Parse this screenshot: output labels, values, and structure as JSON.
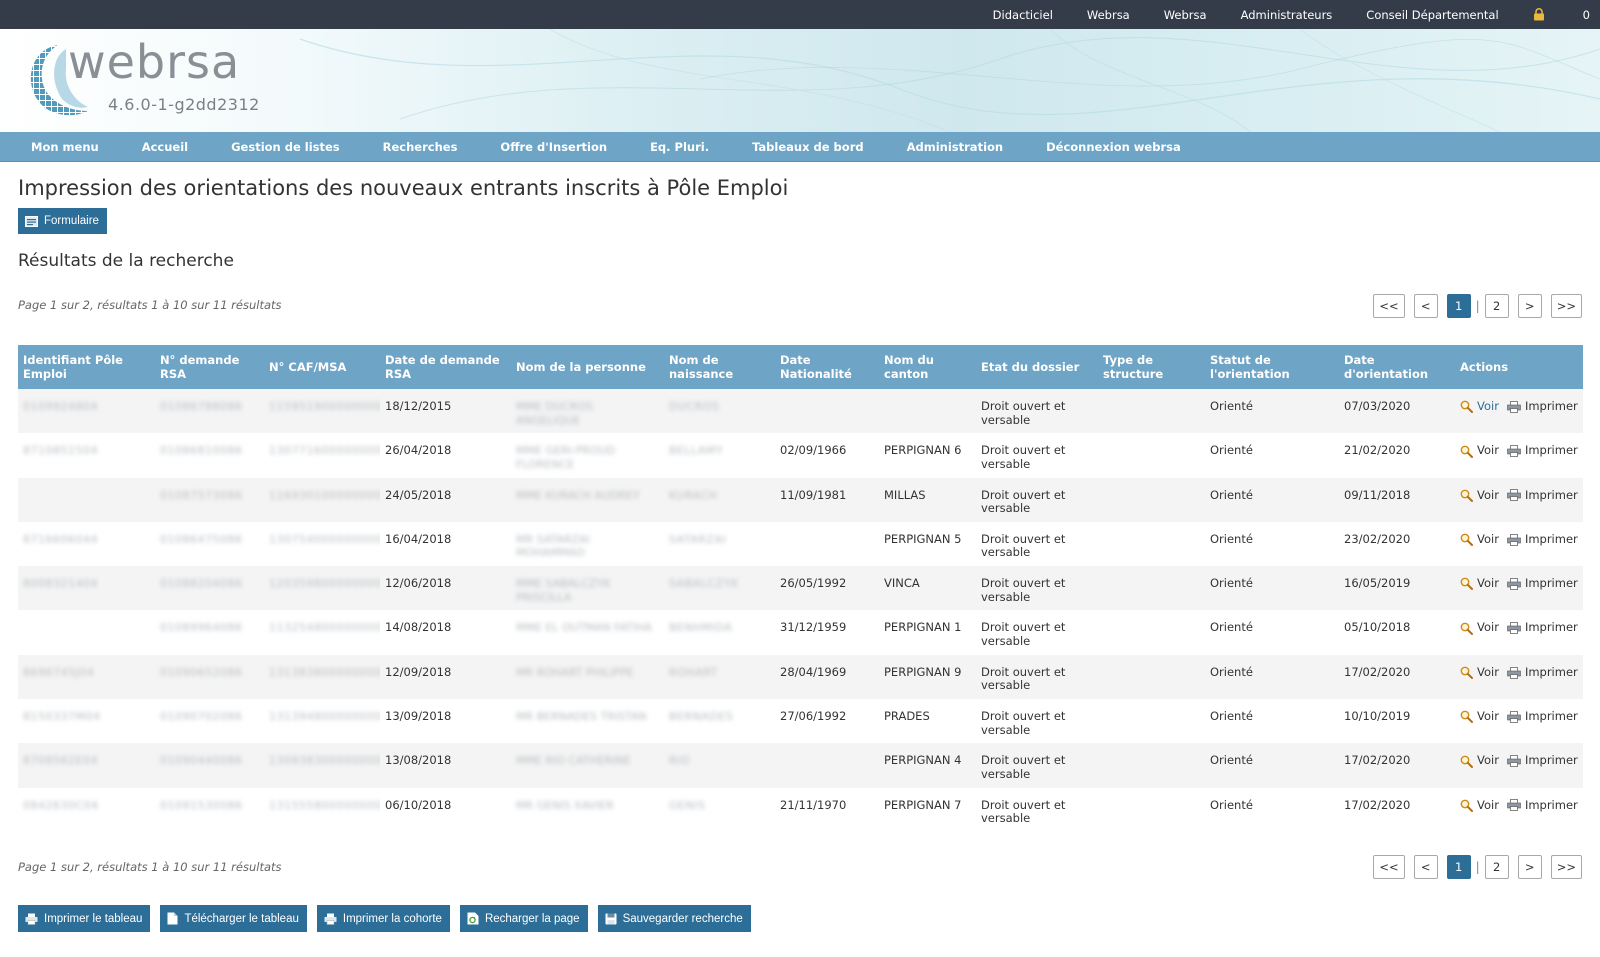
{
  "topbar": {
    "links": [
      "Didacticiel",
      "Webrsa",
      "Webrsa",
      "Administrateurs",
      "Conseil Départemental"
    ],
    "lock_count": "0"
  },
  "logo": {
    "word": "webrsa",
    "version": "4.6.0-1-g2dd2312"
  },
  "nav": [
    "Mon menu",
    "Accueil",
    "Gestion de listes",
    "Recherches",
    "Offre d'Insertion",
    "Eq. Pluri.",
    "Tableaux de bord",
    "Administration",
    "Déconnexion webrsa"
  ],
  "page": {
    "title": "Impression des orientations des nouveaux entrants inscrits à Pôle Emploi",
    "form_button": "Formulaire",
    "results_title": "Résultats de la recherche",
    "page_info": "Page 1 sur 2, résultats 1 à 10 sur 11 résultats"
  },
  "pager": {
    "first": "<<",
    "prev": "<",
    "pages": [
      "1",
      "2"
    ],
    "next": ">",
    "last": ">>",
    "separator": "|"
  },
  "table": {
    "headers": [
      "Identifiant Pôle Emploi",
      "N° demande RSA",
      "N° CAF/MSA",
      "Date de demande RSA",
      "Nom de la personne",
      "Nom de naissance",
      "Date Nationalité",
      "Nom du canton",
      "Etat du dossier",
      "Type de structure",
      "Statut de l'orientation",
      "Date d'orientation",
      "Actions"
    ],
    "action_voir": "Voir",
    "action_imprimer": "Imprimer",
    "rows": [
      {
        "idpe": "0109924804",
        "ndem": "01086788086",
        "caf": "1159519000000000",
        "date_dem": "18/12/2015",
        "nom": "MME DUCROS ANGELIQUE",
        "naiss": "DUCROS",
        "date_nat": "",
        "canton": "",
        "etat": "Droit ouvert et versable",
        "type": "",
        "statut": "Orienté",
        "date_or": "07/03/2020"
      },
      {
        "idpe": "8710851504",
        "ndem": "01086810086",
        "caf": "1307716000000000",
        "date_dem": "26/04/2018",
        "nom": "MME GERI-PROUD FLORENCE",
        "naiss": "BELLAMY",
        "date_nat": "02/09/1966",
        "canton": "PERPIGNAN 6",
        "etat": "Droit ouvert et versable",
        "type": "",
        "statut": "Orienté",
        "date_or": "21/02/2020"
      },
      {
        "idpe": "",
        "ndem": "01087573086",
        "caf": "1169301000000000",
        "date_dem": "24/05/2018",
        "nom": "MME KURACH AUDREY",
        "naiss": "KURACH",
        "date_nat": "11/09/1981",
        "canton": "MILLAS",
        "etat": "Droit ouvert et versable",
        "type": "",
        "statut": "Orienté",
        "date_or": "09/11/2018"
      },
      {
        "idpe": "8716606044",
        "ndem": "01086475086",
        "caf": "1307540000000000",
        "date_dem": "16/04/2018",
        "nom": "MR SATARZAI MOHAMMAD",
        "naiss": "SATARZAI",
        "date_nat": "",
        "canton": "PERPIGNAN 5",
        "etat": "Droit ouvert et versable",
        "type": "",
        "statut": "Orienté",
        "date_or": "23/02/2020"
      },
      {
        "idpe": "8008321404",
        "ndem": "01088204086",
        "caf": "1203598000000000",
        "date_dem": "12/06/2018",
        "nom": "MME SABALCZYK PRISCILLA",
        "naiss": "SABALCZYK",
        "date_nat": "26/05/1992",
        "canton": "VINCA",
        "etat": "Droit ouvert et versable",
        "type": "",
        "statut": "Orienté",
        "date_or": "16/05/2019"
      },
      {
        "idpe": "",
        "ndem": "01089964086",
        "caf": "1132548000000000",
        "date_dem": "14/08/2018",
        "nom": "MME EL OUTMAN FATIHA",
        "naiss": "BENHMIDA",
        "date_nat": "31/12/1959",
        "canton": "PERPIGNAN 1",
        "etat": "Droit ouvert et versable",
        "type": "",
        "statut": "Orienté",
        "date_or": "05/10/2018"
      },
      {
        "idpe": "8696745J04",
        "ndem": "01090652086",
        "caf": "1313838000000000",
        "date_dem": "12/09/2018",
        "nom": "MR ROHART PHILIPPE",
        "naiss": "ROHART",
        "date_nat": "28/04/1969",
        "canton": "PERPIGNAN 9",
        "etat": "Droit ouvert et versable",
        "type": "",
        "statut": "Orienté",
        "date_or": "17/02/2020"
      },
      {
        "idpe": "8150337M04",
        "ndem": "01090702086",
        "caf": "1313948000000000",
        "date_dem": "13/09/2018",
        "nom": "MR BERNADES TRISTAN",
        "naiss": "BERNADES",
        "date_nat": "27/06/1992",
        "canton": "PRADES",
        "etat": "Droit ouvert et versable",
        "type": "",
        "statut": "Orienté",
        "date_or": "10/10/2019"
      },
      {
        "idpe": "8708562E04",
        "ndem": "01090440086",
        "caf": "1309383000000000",
        "date_dem": "13/08/2018",
        "nom": "MME RIO CATHERINE",
        "naiss": "RIO",
        "date_nat": "",
        "canton": "PERPIGNAN 4",
        "etat": "Droit ouvert et versable",
        "type": "",
        "statut": "Orienté",
        "date_or": "17/02/2020"
      },
      {
        "idpe": "0842630C04",
        "ndem": "01091530086",
        "caf": "1315558000000000",
        "date_dem": "06/10/2018",
        "nom": "MR GENIS XAVIER",
        "naiss": "GENIS",
        "date_nat": "21/11/1970",
        "canton": "PERPIGNAN 7",
        "etat": "Droit ouvert et versable",
        "type": "",
        "statut": "Orienté",
        "date_or": "17/02/2020"
      }
    ]
  },
  "bottom_buttons": [
    "Imprimer le tableau",
    "Télécharger le tableau",
    "Imprimer la cohorte",
    "Recharger la page",
    "Sauvegarder recherche"
  ],
  "colors": {
    "topbar": "#343c4a",
    "nav": "#6ea4c6",
    "button": "#2c6e97"
  },
  "icons": {
    "lock": "lock-icon",
    "form": "form-icon",
    "voir": "magnifier-icon",
    "imprimer": "printer-icon"
  }
}
